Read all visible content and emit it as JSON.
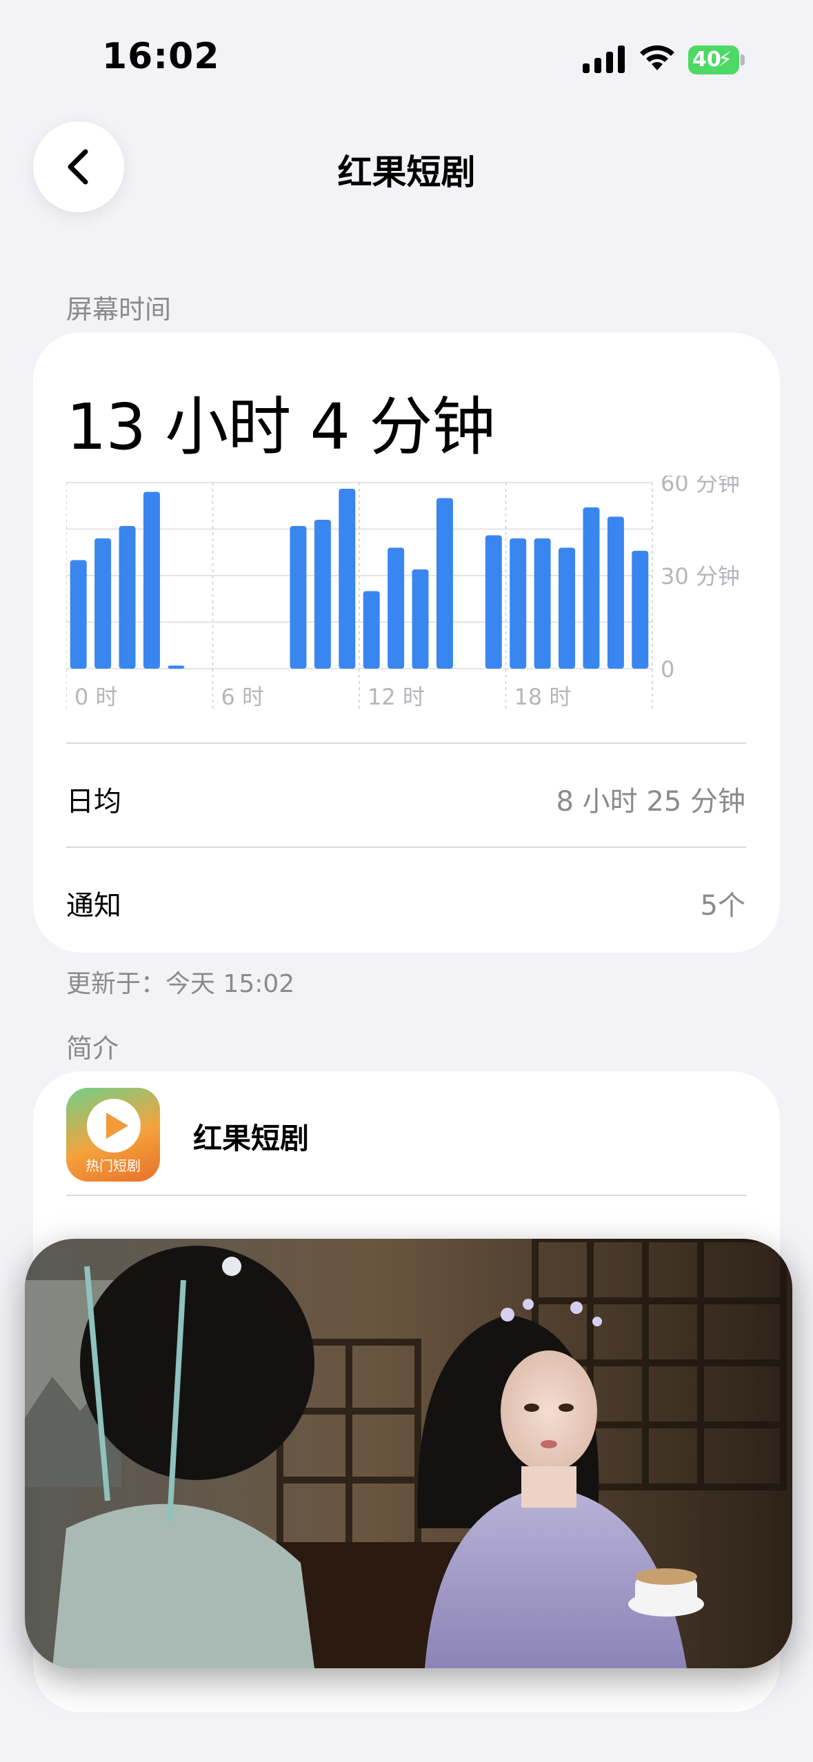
{
  "status_bar": {
    "time": "16:02",
    "battery": "40"
  },
  "nav": {
    "title": "红果短剧"
  },
  "screen_time": {
    "section_label": "屏幕时间",
    "total": "13 小时 4 分钟",
    "daily_avg_label": "日均",
    "daily_avg_value": "8 小时 25 分钟",
    "notifications_label": "通知",
    "notifications_value": "5个",
    "updated": "更新于：今天 15:02"
  },
  "chart_data": {
    "type": "bar",
    "x_tick_labels": [
      "0 时",
      "6 时",
      "12 时",
      "18 时"
    ],
    "y_tick_labels": [
      "60 分钟",
      "30 分钟",
      "0"
    ],
    "ylim": [
      0,
      60
    ],
    "categories": [
      "0",
      "1",
      "2",
      "3",
      "4",
      "5",
      "6",
      "7",
      "8",
      "9",
      "10",
      "11",
      "12",
      "13",
      "14",
      "15",
      "16",
      "17",
      "18",
      "19",
      "20",
      "21",
      "22",
      "23"
    ],
    "values": [
      35,
      42,
      46,
      57,
      1,
      0,
      0,
      0,
      0,
      46,
      48,
      58,
      25,
      39,
      32,
      55,
      0,
      43,
      42,
      42,
      39,
      52,
      49,
      38
    ],
    "color": "#3a86f0",
    "grid": true
  },
  "intro": {
    "section_label": "简介",
    "app_name": "红果短剧",
    "app_icon_tag": "热门短剧"
  },
  "colors": {
    "accent": "#3a86f0",
    "background": "#f2f2f7",
    "battery": "#4cd964"
  }
}
